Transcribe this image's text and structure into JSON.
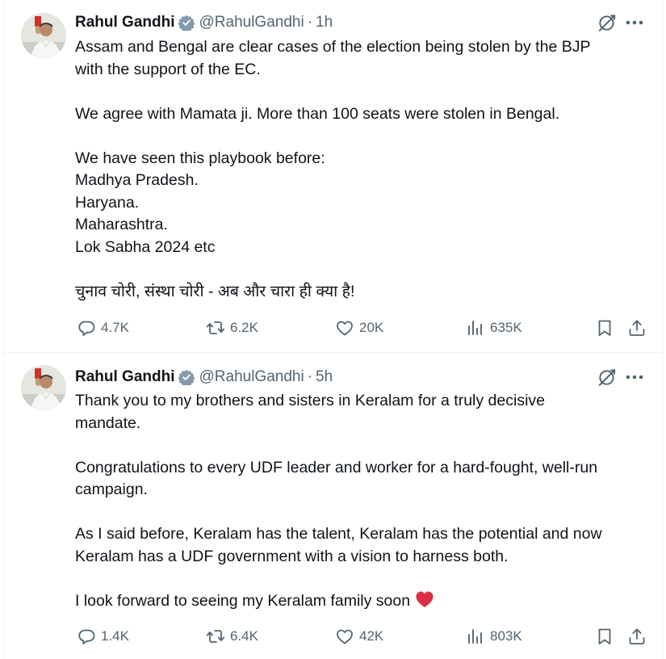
{
  "tweets": [
    {
      "author": {
        "name": "Rahul Gandhi",
        "handle": "@RahulGandhi",
        "verified": true
      },
      "separator": "·",
      "time": "1h",
      "paragraphs": [
        [
          "Assam and Bengal are clear cases of the election being stolen by the BJP",
          "with the support of the EC."
        ],
        [
          "We agree with Mamata ji. More than 100 seats were stolen in Bengal."
        ],
        [
          "We have seen this playbook before:",
          "Madhya Pradesh.",
          "Haryana.",
          "Maharashtra.",
          "Lok Sabha 2024 etc"
        ],
        [
          "चुनाव चोरी, संस्था चोरी - अब और चारा ही क्या है!"
        ]
      ],
      "stats": {
        "replies": "4.7K",
        "reposts": "6.2K",
        "likes": "20K",
        "views": "635K"
      }
    },
    {
      "author": {
        "name": "Rahul Gandhi",
        "handle": "@RahulGandhi",
        "verified": true
      },
      "separator": "·",
      "time": "5h",
      "paragraphs": [
        [
          "Thank you to my brothers and sisters in Keralam for a truly decisive",
          "mandate."
        ],
        [
          "Congratulations to every UDF leader and worker for a hard-fought, well-run",
          "campaign."
        ],
        [
          "As I said before, Keralam has the talent, Keralam has the potential and now",
          "Keralam has a UDF government with a vision to harness both."
        ],
        [
          "I look forward to seeing my Keralam family soon"
        ]
      ],
      "stats": {
        "replies": "1.4K",
        "reposts": "6.4K",
        "likes": "42K",
        "views": "803K"
      }
    }
  ],
  "colors": {
    "text": "#0f1419",
    "secondary": "#536471",
    "verified": "#829aab",
    "heart": "#e0245e",
    "divider": "#eff3f4"
  },
  "icons": {
    "verified": "verified-badge-icon",
    "grok": "grok-icon",
    "more": "more-dots-icon",
    "reply": "reply-icon",
    "repost": "repost-icon",
    "like": "heart-icon",
    "views": "views-chart-icon",
    "bookmark": "bookmark-icon",
    "share": "share-icon",
    "emoji": "red-heart-emoji-icon"
  }
}
